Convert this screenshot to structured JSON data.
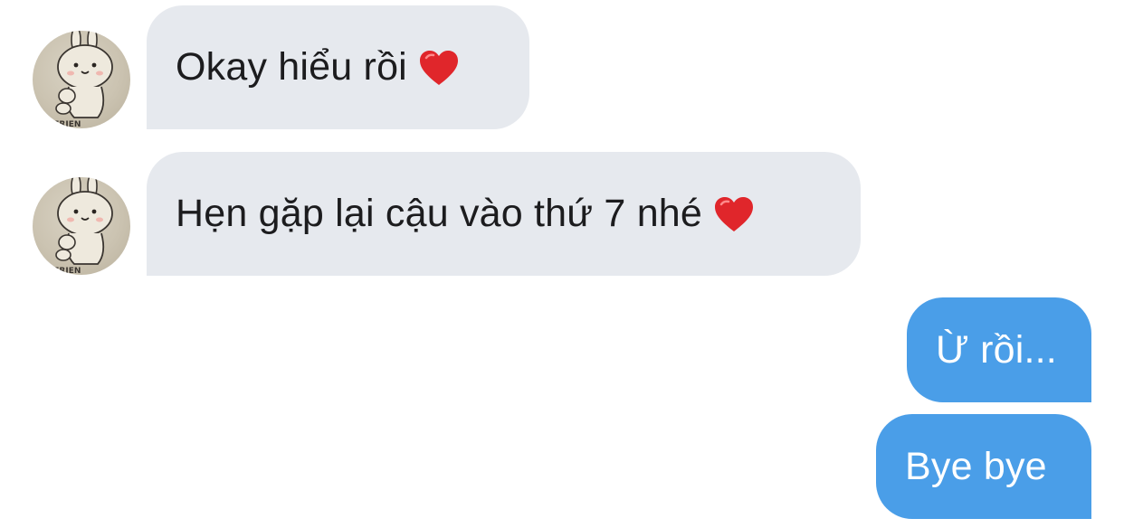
{
  "messages": [
    {
      "direction": "incoming",
      "text": "Okay hiểu rồi",
      "emoji": "heart-icon"
    },
    {
      "direction": "incoming",
      "text": "Hẹn gặp lại cậu vào thứ 7 nhé",
      "emoji": "heart-icon"
    },
    {
      "direction": "outgoing",
      "text": "Ừ rồi..."
    },
    {
      "direction": "outgoing",
      "text": "Bye bye"
    }
  ],
  "colors": {
    "incoming_bubble": "#e6e9ee",
    "outgoing_bubble": "#4a9ee8",
    "incoming_text": "#1c1c1e",
    "outgoing_text": "#ffffff",
    "heart": "#e0262b"
  }
}
